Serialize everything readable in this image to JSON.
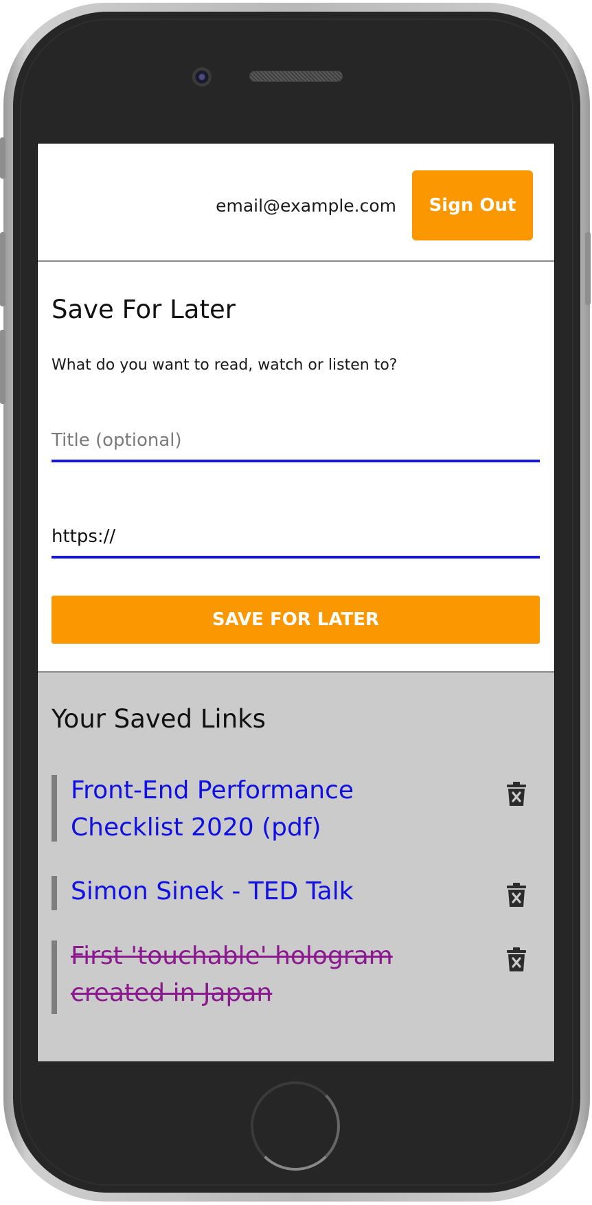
{
  "header": {
    "email": "email@example.com",
    "signout_label": "Sign Out"
  },
  "form": {
    "title": "Save For Later",
    "description": "What do you want to read, watch or listen to?",
    "title_placeholder": "Title (optional)",
    "url_value": "https://",
    "save_label": "SAVE FOR LATER"
  },
  "links": {
    "title": "Your Saved Links",
    "items": [
      {
        "label": "Front-End Performance Checklist 2020 (pdf)",
        "done": false
      },
      {
        "label": "Simon Sinek - TED Talk",
        "done": false
      },
      {
        "label": "First 'touchable' hologram created in Japan",
        "done": true
      }
    ]
  },
  "colors": {
    "accent": "#fb9700",
    "link": "#1010e0",
    "visited_link": "#8a1a8e",
    "input_underline": "#1515e0",
    "links_background": "#cbcbcb"
  },
  "icons": {
    "delete": "trash-can-icon"
  }
}
